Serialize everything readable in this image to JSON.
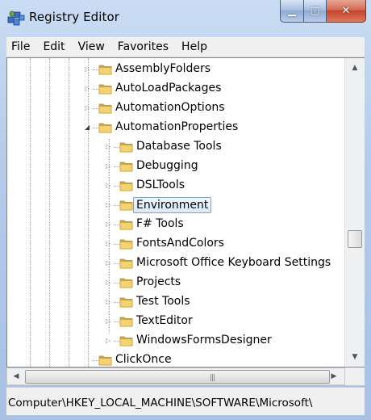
{
  "window": {
    "title": "Registry Editor"
  },
  "menu": [
    "File",
    "Edit",
    "View",
    "Favorites",
    "Help"
  ],
  "tree": [
    {
      "label": "AssemblyFolders",
      "expander": "collapsed"
    },
    {
      "label": "AutoLoadPackages",
      "expander": "collapsed"
    },
    {
      "label": "AutomationOptions",
      "expander": "collapsed"
    },
    {
      "label": "AutomationProperties",
      "expander": "expanded"
    },
    {
      "label": "Database Tools",
      "expander": "collapsed"
    },
    {
      "label": "Debugging",
      "expander": "collapsed"
    },
    {
      "label": "DSLTools",
      "expander": "collapsed"
    },
    {
      "label": "Environment",
      "expander": "collapsed",
      "selected": true
    },
    {
      "label": "F# Tools",
      "expander": "collapsed"
    },
    {
      "label": "FontsAndColors",
      "expander": "collapsed"
    },
    {
      "label": "Microsoft Office Keyboard Settings",
      "expander": "collapsed"
    },
    {
      "label": "Projects",
      "expander": "collapsed"
    },
    {
      "label": "Test Tools",
      "expander": "collapsed"
    },
    {
      "label": "TextEditor",
      "expander": "collapsed"
    },
    {
      "label": "WindowsFormsDesigner",
      "expander": "collapsed"
    },
    {
      "label": "ClickOnce",
      "expander": "none"
    }
  ],
  "statusbar": {
    "path": "Computer\\HKEY_LOCAL_MACHINE\\SOFTWARE\\Microsoft\\"
  },
  "colors": {
    "folder": "#e8c14a",
    "selection_border": "#7da2ce",
    "close_button": "#c7432a"
  }
}
